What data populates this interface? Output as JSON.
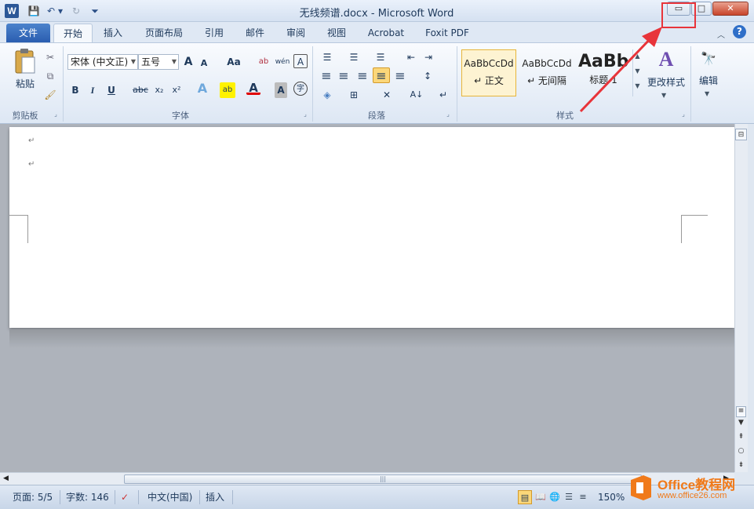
{
  "window": {
    "title": "无线频谱.docx - Microsoft Word",
    "app_icon_letter": "W",
    "min_glyph": "▭",
    "max_glyph": "□",
    "close_glyph": "✕"
  },
  "quick_access": [
    {
      "name": "save-icon",
      "glyph": "💾"
    },
    {
      "name": "undo-icon",
      "glyph": "↶"
    },
    {
      "name": "dropdown-icon",
      "glyph": "▾"
    },
    {
      "name": "redo-icon",
      "glyph": "↻"
    },
    {
      "name": "customize-icon",
      "glyph": "⏷"
    }
  ],
  "tabs": {
    "file": "文件",
    "home": "开始",
    "insert": "插入",
    "layout": "页面布局",
    "references": "引用",
    "mailings": "邮件",
    "review": "审阅",
    "view": "视图",
    "acrobat": "Acrobat",
    "foxit": "Foxit PDF"
  },
  "ribbon": {
    "clipboard": {
      "label": "剪贴板",
      "paste": "粘贴",
      "cut_glyph": "✂",
      "copy_glyph": "⧉",
      "format_painter_glyph": "🖌"
    },
    "font": {
      "label": "字体",
      "font_name": "宋体 (中文正)",
      "font_size": "五号",
      "grow": "A",
      "shrink": "A",
      "change_case": "Aa",
      "clear_format": "ab",
      "phonetic": "wén",
      "char_border": "A",
      "bold": "B",
      "italic": "I",
      "underline": "U",
      "strike": "abc",
      "subscript": "x₂",
      "superscript": "x²",
      "text_effect": "A",
      "highlight": "ab",
      "font_color": "A",
      "char_shading": "A",
      "enclose": "字"
    },
    "paragraph": {
      "label": "段落",
      "bullets": "☰",
      "numbering": "☰",
      "multilevel": "☰",
      "decrease_indent": "⇤",
      "increase_indent": "⇥",
      "align_left": "≡",
      "align_center": "≡",
      "align_right": "≡",
      "justify": "≡",
      "distributed": "≡",
      "line_spacing": "↕",
      "shading": "◈",
      "borders": "⊞",
      "asian_layout": "✕",
      "sort": "A↓",
      "show_marks": "↵"
    },
    "styles": {
      "label": "样式",
      "items": [
        {
          "sample": "AaBbCcDd",
          "name": "↵ 正文"
        },
        {
          "sample": "AaBbCcDd",
          "name": "↵ 无间隔"
        },
        {
          "sample": "AaBb",
          "name": "标题 1"
        }
      ],
      "change_styles": "更改样式"
    },
    "editing": {
      "label": "编辑",
      "glyph": "🔭"
    }
  },
  "document": {
    "paragraph_mark": "↵"
  },
  "statusbar": {
    "page": "页面: 5/5",
    "words": "字数: 146",
    "language": "中文(中国)",
    "mode": "插入",
    "zoom": "150%"
  },
  "watermark": {
    "line1": "Office教程网",
    "line2": "www.office26.com"
  },
  "colors": {
    "annotation": "#e8343a",
    "file_tab": "#2a5db0",
    "watermark": "#f07a1a"
  }
}
